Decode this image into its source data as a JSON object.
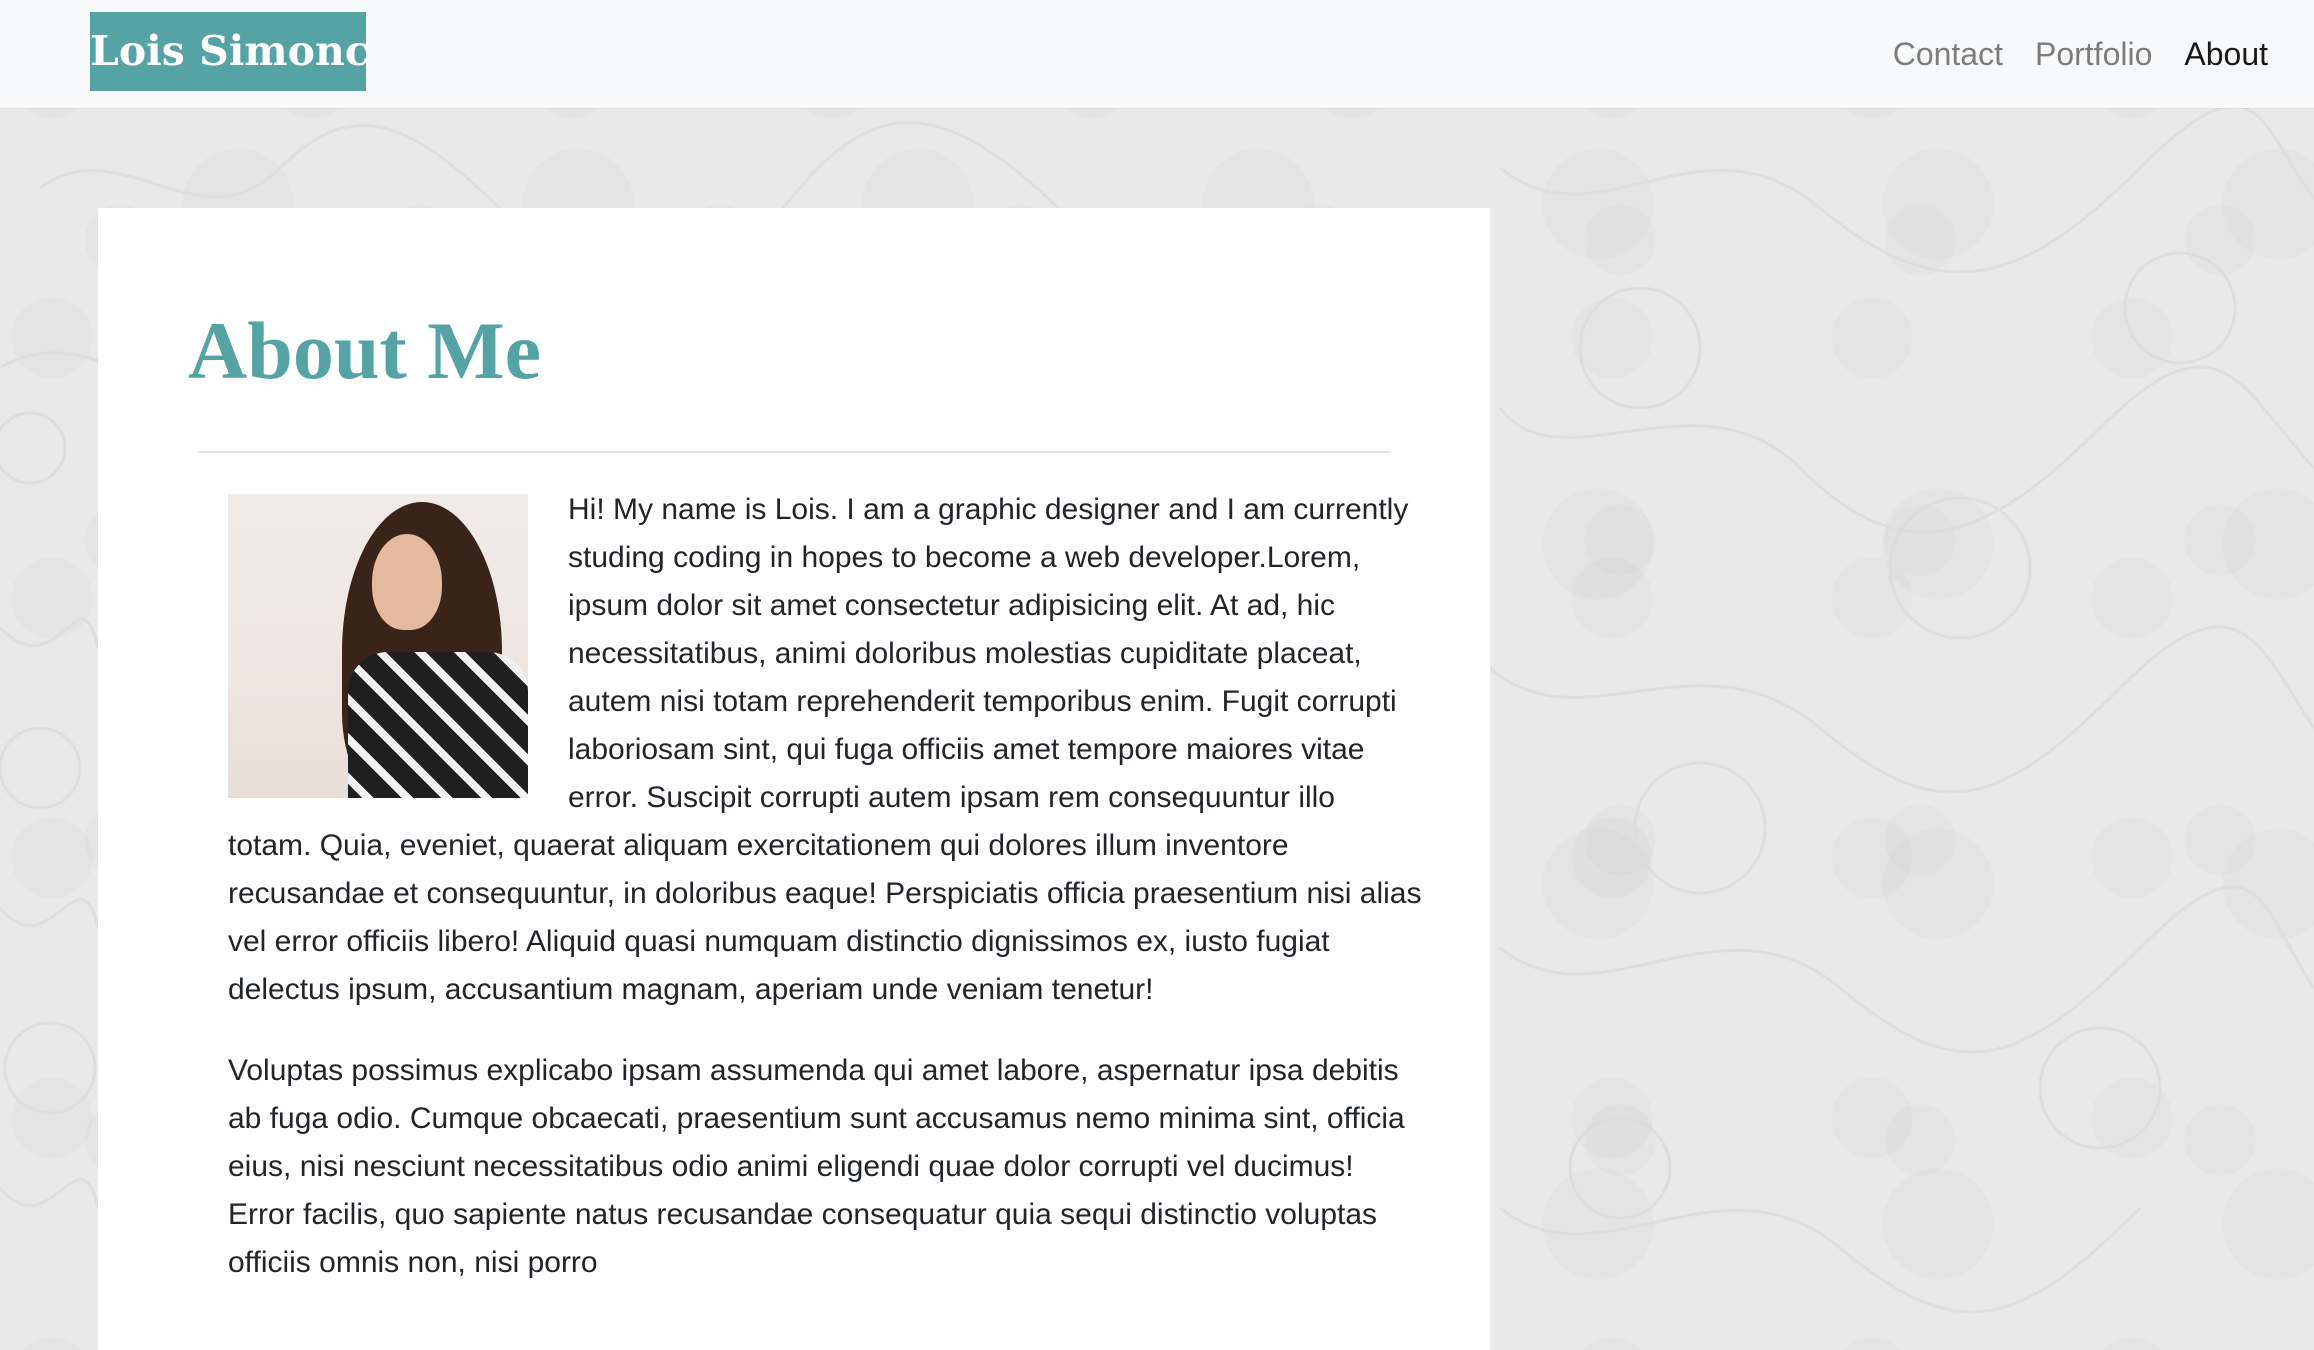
{
  "nav": {
    "brand": "Lois Simonca",
    "links": [
      {
        "label": "Contact"
      },
      {
        "label": "Portfolio"
      },
      {
        "label": "About"
      }
    ]
  },
  "about": {
    "title": "About Me",
    "paragraph1": "Hi! My name is Lois. I am a graphic designer and I am currently studing coding in hopes to become a web developer.Lorem, ipsum dolor sit amet consectetur adipisicing elit. At ad, hic necessitatibus, animi doloribus molestias cupiditate placeat, autem nisi totam reprehenderit temporibus enim. Fugit corrupti laboriosam sint, qui fuga officiis amet tempore maiores vitae error. Suscipit corrupti autem ipsam rem consequuntur illo totam. Quia, eveniet, quaerat aliquam exercitationem qui dolores illum inventore recusandae et consequuntur, in doloribus eaque! Perspiciatis officia praesentium nisi alias vel error officiis libero! Aliquid quasi numquam distinctio dignissimos ex, iusto fugiat delectus ipsum, accusantium magnam, aperiam unde veniam tenetur!",
    "paragraph2": "Voluptas possimus explicabo ipsam assumenda qui amet labore, aspernatur ipsa debitis ab fuga odio. Cumque obcaecati, praesentium sunt accusamus nemo minima sint, officia eius, nisi nesciunt necessitatibus odio animi eligendi quae dolor corrupti vel ducimus! Error facilis, quo sapiente natus recusandae consequatur quia sequi distinctio voluptas officiis omnis non, nisi porro"
  },
  "colors": {
    "accent": "#56a3a6",
    "navbar_bg": "#f8f9fa",
    "page_bg": "#e9e9e9"
  }
}
